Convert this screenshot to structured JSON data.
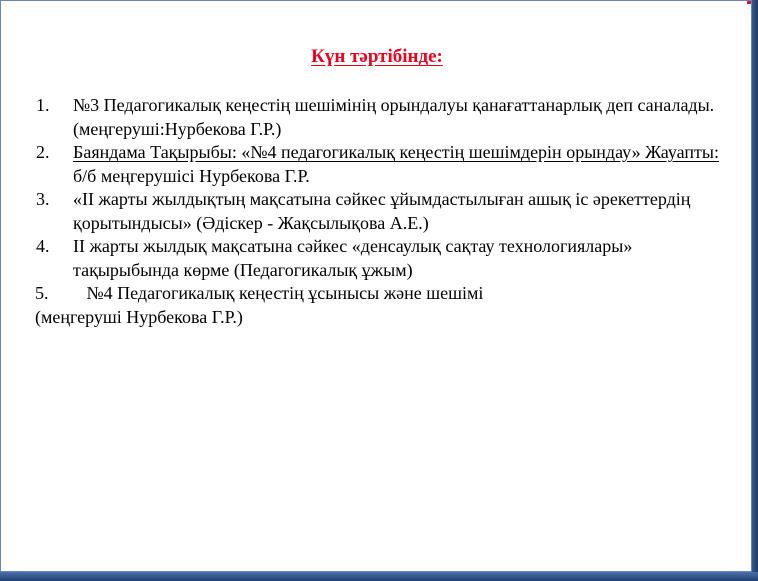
{
  "slide": {
    "title": "Күн тәртібінде:",
    "items": [
      {
        "number": "1.",
        "text": "№3 Педагогикалық  кеңестің шешімінің орындалуы қанағаттанарлық деп  саналады. (меңгеруші:Нурбекова  Г.Р.)"
      },
      {
        "number": "2.",
        "part1": "Баяндама Тақырыбы: «№4 педагогикалық кеңестің шешімдерін орындау»  Жауапты:",
        "part2": " б/б меңгерушісі Нурбекова Г.Р."
      },
      {
        "number": "3.",
        "text": "«ІІ жарты жылдықтың мақсатына сәйкес ұйымдастылыған ашық іс әрекеттердің қорытындысы» (Әдіскер - Жақсылықова  А.Е.)"
      },
      {
        "number": "4.",
        "text": " ІІ жарты жылдық мақсатына  сәйкес «денсаулық сақтау технологиялары»  тақырыбында көрме  (Педагогикалық ұжым)"
      },
      {
        "number": "5.",
        "line1": "№4 Педагогикалық  кеңестің ұсынысы және шешімі",
        "line2": "(меңгеруші Нурбекова  Г.Р.)"
      }
    ]
  }
}
